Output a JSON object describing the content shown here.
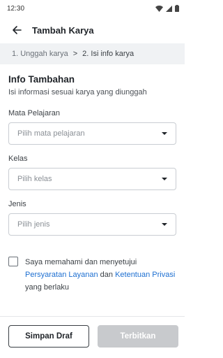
{
  "status_bar": {
    "time": "12:30"
  },
  "app_bar": {
    "title": "Tambah Karya"
  },
  "stepper": {
    "step1": "1. Unggah karya",
    "separator": ">",
    "step2": "2. Isi info karya"
  },
  "section": {
    "title": "Info Tambahan",
    "subtitle": "Isi informasi sesuai karya yang diunggah"
  },
  "fields": {
    "subject": {
      "label": "Mata Pelajaran",
      "placeholder": "Pilih mata pelajaran"
    },
    "class": {
      "label": "Kelas",
      "placeholder": "Pilih kelas"
    },
    "type": {
      "label": "Jenis",
      "placeholder": "Pilih jenis"
    }
  },
  "agreement": {
    "prefix": "Saya memahami dan menyetujui",
    "terms_link": "Persyaratan Layanan",
    "conjunction": "dan",
    "privacy_link": "Ketentuan Privasi",
    "suffix": "yang berlaku",
    "checked": false
  },
  "buttons": {
    "save_draft": "Simpan Draf",
    "publish": "Terbitkan"
  },
  "colors": {
    "link": "#1d6fd1",
    "stepper_bg": "#f0f2f4",
    "disabled_button": "#c8cacd"
  },
  "icons": [
    "back-arrow-icon",
    "wifi-icon",
    "signal-icon",
    "battery-icon",
    "dropdown-caret-icon"
  ]
}
